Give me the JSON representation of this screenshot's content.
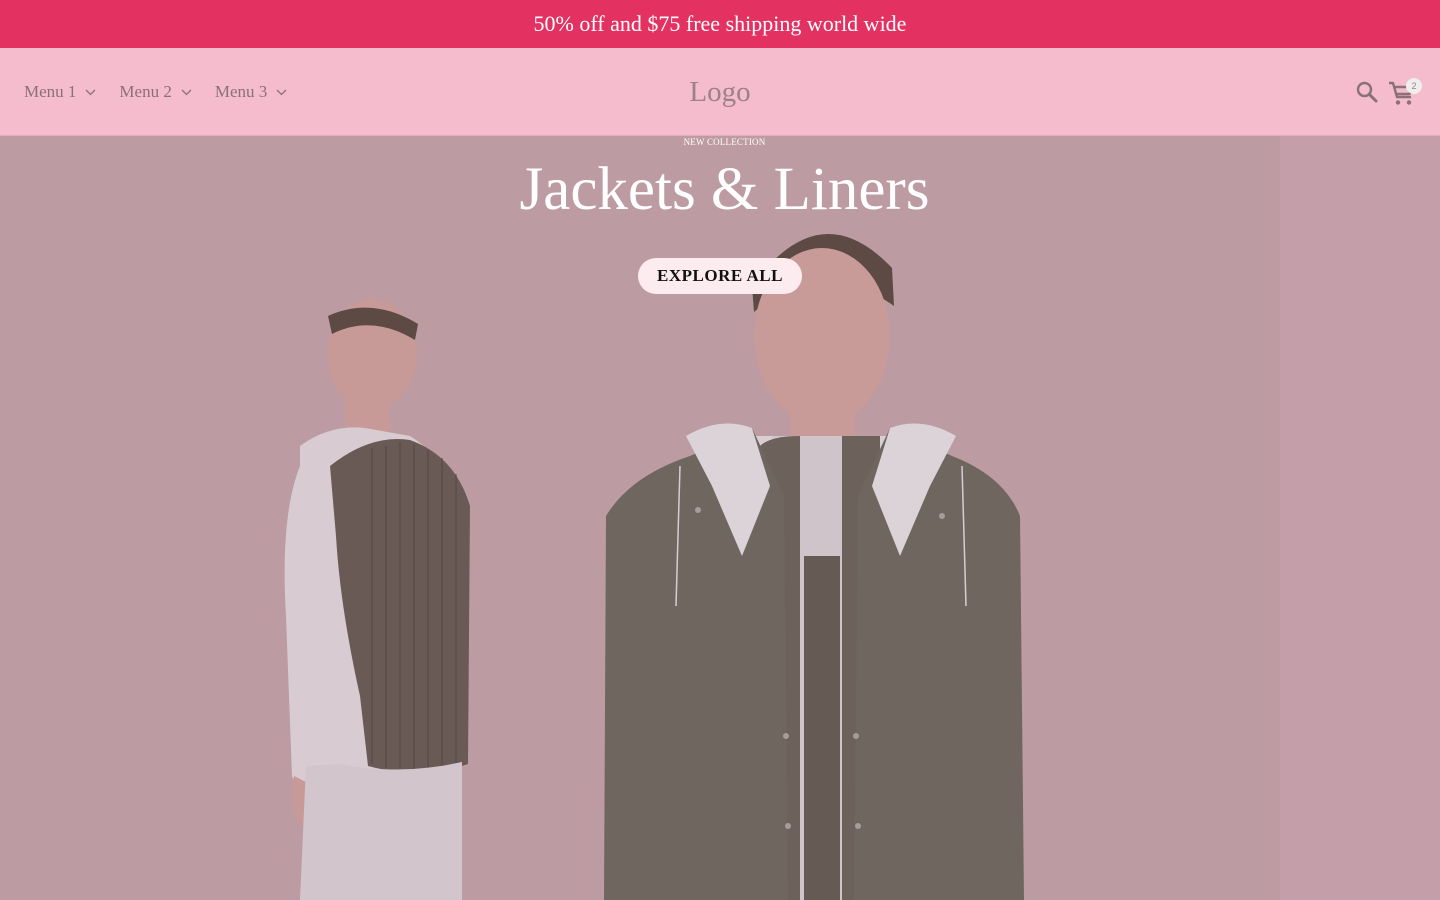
{
  "announcement": {
    "text": "50% off and $75 free shipping world wide"
  },
  "header": {
    "menus": [
      {
        "label": "Menu 1",
        "icon": "chevron-down-icon"
      },
      {
        "label": "Menu 2",
        "icon": "chevron-down-icon"
      },
      {
        "label": "Menu 3",
        "icon": "chevron-down-icon"
      }
    ],
    "logo": "Logo",
    "icons": [
      "search-icon",
      "cart-icon"
    ],
    "cart_count": "2"
  },
  "hero": {
    "eyebrow": "NEW COLLECTION",
    "headline": "Jackets & Liners",
    "cta_label": "EXPLORE ALL"
  },
  "colors": {
    "announcement_bg": "#e33262",
    "header_bg": "#f5bccd",
    "hero_overlay": "#bd9ba3",
    "cta_bg": "#fdecef"
  }
}
